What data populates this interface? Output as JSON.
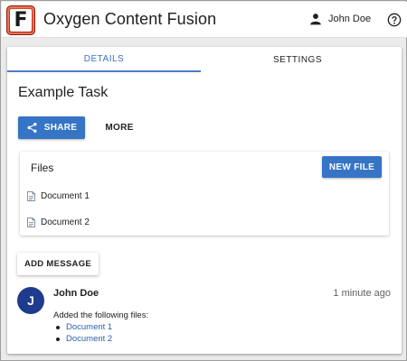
{
  "header": {
    "app_title": "Oxygen Content Fusion",
    "logo_letter": "F",
    "user_name": "John Doe",
    "help_icon": "help-circle-icon",
    "user_icon": "person-icon"
  },
  "tabs": [
    {
      "label": "DETAILS",
      "active": true
    },
    {
      "label": "SETTINGS",
      "active": false
    }
  ],
  "task": {
    "title": "Example Task",
    "share_label": "SHARE",
    "more_label": "MORE"
  },
  "files": {
    "title": "Files",
    "new_file_label": "NEW FILE",
    "items": [
      "Document 1",
      "Document 2"
    ]
  },
  "add_message_label": "ADD MESSAGE",
  "message": {
    "avatar_initial": "J",
    "author": "John Doe",
    "time": "1 minute ago",
    "text": "Added the following files:",
    "files": [
      "Document 1",
      "Document 2"
    ]
  },
  "colors": {
    "accent": "#3674c6",
    "avatar": "#1f3b8e",
    "link": "#2c5fae",
    "logo": "#c62f17"
  }
}
